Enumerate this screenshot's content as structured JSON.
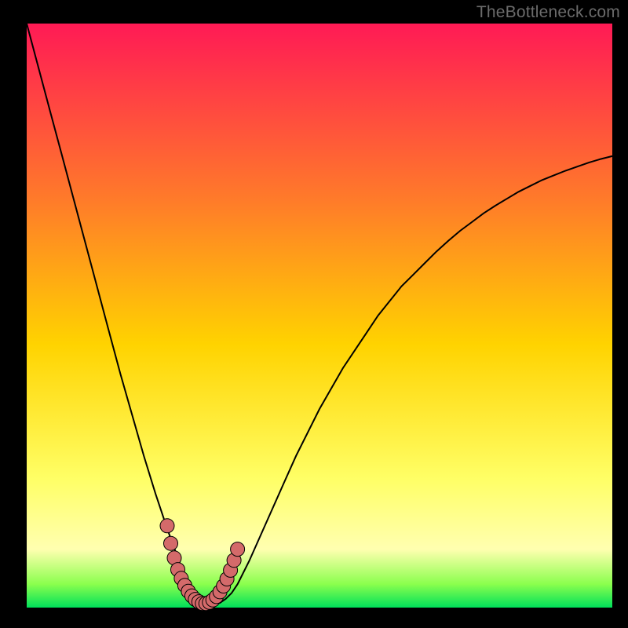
{
  "watermark": "TheBottleneck.com",
  "colors": {
    "bg_black": "#000000",
    "grad_top": "#ff1a55",
    "grad_mid1": "#ff7a2a",
    "grad_mid2": "#ffd300",
    "grad_mid3": "#ffff66",
    "grad_low": "#ffffb0",
    "grad_greenish": "#8aff4d",
    "grad_bottom": "#00e05a",
    "curve": "#000000",
    "marker_fill": "#d46a6a",
    "marker_stroke": "#000000"
  },
  "chart_data": {
    "type": "line",
    "title": "",
    "xlabel": "",
    "ylabel": "",
    "xlim": [
      0,
      100
    ],
    "ylim": [
      0,
      100
    ],
    "legend": false,
    "grid": false,
    "x": [
      0,
      2,
      4,
      6,
      8,
      10,
      12,
      14,
      16,
      18,
      20,
      22,
      24,
      26,
      27,
      28,
      29,
      30,
      31,
      32,
      33,
      34,
      35,
      36,
      38,
      40,
      42,
      44,
      46,
      48,
      50,
      52,
      54,
      56,
      58,
      60,
      62,
      64,
      66,
      68,
      70,
      72,
      74,
      76,
      78,
      80,
      82,
      84,
      86,
      88,
      90,
      92,
      94,
      96,
      98,
      100
    ],
    "y": [
      100,
      92.5,
      85,
      77.5,
      70,
      62.5,
      55,
      47.5,
      40,
      33,
      26,
      19.5,
      13.5,
      8,
      5.5,
      3.5,
      2,
      1,
      0.5,
      0.5,
      0.8,
      1.5,
      2.5,
      4,
      8,
      12.5,
      17,
      21.5,
      26,
      30,
      34,
      37.5,
      41,
      44,
      47,
      50,
      52.5,
      55,
      57,
      59,
      61,
      62.8,
      64.5,
      66,
      67.5,
      68.8,
      70,
      71.2,
      72.2,
      73.2,
      74,
      74.8,
      75.5,
      76.2,
      76.8,
      77.3
    ],
    "marker_points_x": [
      24.0,
      24.6,
      25.2,
      25.8,
      26.4,
      27.0,
      27.6,
      28.2,
      28.8,
      29.4,
      30.0,
      30.6,
      31.2,
      31.8,
      32.4,
      33.0,
      33.6,
      34.2,
      34.8,
      35.4,
      36.0
    ],
    "marker_points_y": [
      14.0,
      11.0,
      8.5,
      6.5,
      5.0,
      3.8,
      2.8,
      2.0,
      1.4,
      1.0,
      0.7,
      0.7,
      0.9,
      1.3,
      1.9,
      2.7,
      3.7,
      4.9,
      6.4,
      8.1,
      10.0
    ]
  }
}
